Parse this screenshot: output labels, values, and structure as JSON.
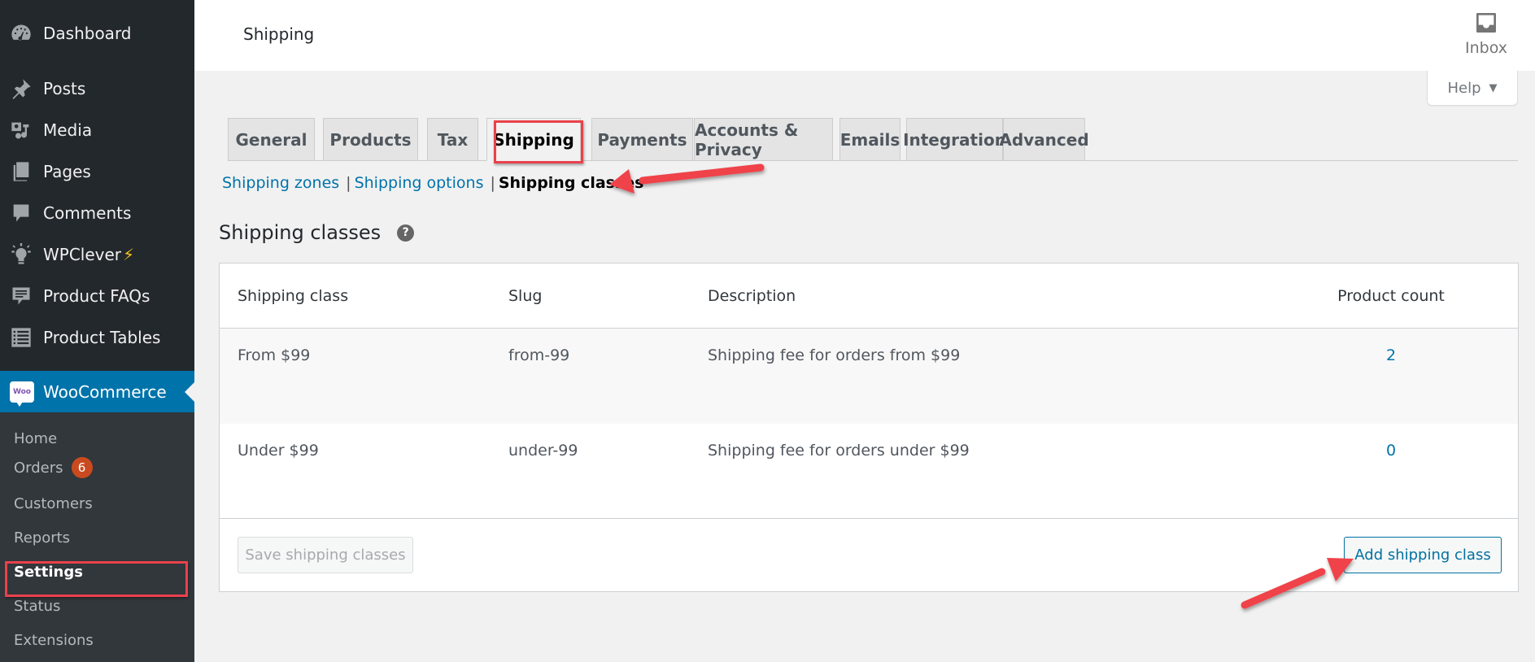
{
  "sidebar": {
    "menu": [
      {
        "label": "Dashboard",
        "icon": "dashboard-icon"
      },
      {
        "label": "Posts",
        "icon": "pin-icon"
      },
      {
        "label": "Media",
        "icon": "media-icon"
      },
      {
        "label": "Pages",
        "icon": "pages-icon"
      },
      {
        "label": "Comments",
        "icon": "comment-icon"
      },
      {
        "label": "WPClever",
        "icon": "lightbulb-icon",
        "suffix": "⚡"
      },
      {
        "label": "Product FAQs",
        "icon": "faq-icon"
      },
      {
        "label": "Product Tables",
        "icon": "table-icon"
      }
    ],
    "woocommerce": {
      "label": "WooCommerce",
      "logo_text": "Woo"
    },
    "submenu": [
      {
        "label": "Home"
      },
      {
        "label": "Orders",
        "badge": "6"
      },
      {
        "label": "Customers"
      },
      {
        "label": "Reports"
      },
      {
        "label": "Settings"
      },
      {
        "label": "Status"
      },
      {
        "label": "Extensions"
      }
    ]
  },
  "header": {
    "title": "Shipping",
    "inbox_label": "Inbox",
    "help_label": "Help",
    "help_caret": "▼"
  },
  "tabs": [
    {
      "label": "General"
    },
    {
      "label": "Products"
    },
    {
      "label": "Tax"
    },
    {
      "label": "Shipping",
      "active": true
    },
    {
      "label": "Payments"
    },
    {
      "label": "Accounts & Privacy"
    },
    {
      "label": "Emails"
    },
    {
      "label": "Integration"
    },
    {
      "label": "Advanced"
    }
  ],
  "subnav": {
    "zones": "Shipping zones",
    "options": "Shipping options",
    "classes": "Shipping classes",
    "separator": "|"
  },
  "section": {
    "title": "Shipping classes",
    "help_glyph": "?"
  },
  "table": {
    "columns": [
      "Shipping class",
      "Slug",
      "Description",
      "Product count"
    ],
    "rows": [
      {
        "name": "From $99",
        "slug": "from-99",
        "description": "Shipping fee for orders from $99",
        "count": "2"
      },
      {
        "name": "Under $99",
        "slug": "under-99",
        "description": "Shipping fee for orders under $99",
        "count": "0"
      }
    ],
    "save_label": "Save shipping classes",
    "add_label": "Add shipping class"
  },
  "colors": {
    "sidebar_bg": "#23282d",
    "submenu_bg": "#32373c",
    "accent": "#0073aa",
    "badge": "#ca4a1f",
    "annotation": "#e9414b"
  }
}
